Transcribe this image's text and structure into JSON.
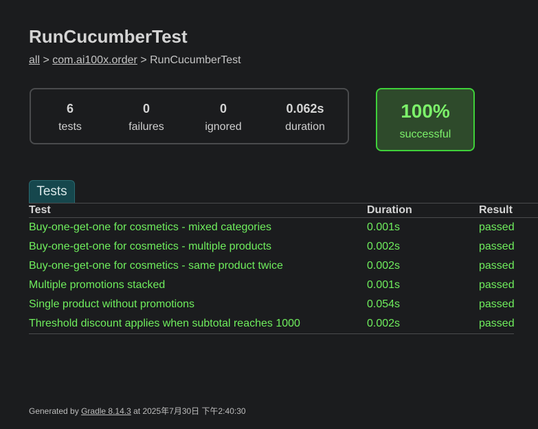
{
  "title": "RunCucumberTest",
  "breadcrumb": {
    "all": "all",
    "sep1": " > ",
    "package": "com.ai100x.order",
    "sep2": " > ",
    "current": "RunCucumberTest"
  },
  "summary": {
    "tests": {
      "value": "6",
      "label": "tests"
    },
    "failures": {
      "value": "0",
      "label": "failures"
    },
    "ignored": {
      "value": "0",
      "label": "ignored"
    },
    "duration": {
      "value": "0.062s",
      "label": "duration"
    }
  },
  "success": {
    "percent": "100%",
    "label": "successful"
  },
  "tab": {
    "label": "Tests"
  },
  "table": {
    "headers": {
      "test": "Test",
      "duration": "Duration",
      "result": "Result"
    },
    "rows": [
      {
        "test": "Buy-one-get-one for cosmetics - mixed categories",
        "duration": "0.001s",
        "result": "passed"
      },
      {
        "test": "Buy-one-get-one for cosmetics - multiple products",
        "duration": "0.002s",
        "result": "passed"
      },
      {
        "test": "Buy-one-get-one for cosmetics - same product twice",
        "duration": "0.002s",
        "result": "passed"
      },
      {
        "test": "Multiple promotions stacked",
        "duration": "0.001s",
        "result": "passed"
      },
      {
        "test": "Single product without promotions",
        "duration": "0.054s",
        "result": "passed"
      },
      {
        "test": "Threshold discount applies when subtotal reaches 1000",
        "duration": "0.002s",
        "result": "passed"
      }
    ]
  },
  "footer": {
    "prefix": "Generated by ",
    "link": "Gradle 8.14.3",
    "suffix": " at 2025年7月30日 下午2:40:30"
  },
  "colors": {
    "background": "#1b1c1e",
    "success_border": "#3fd13a",
    "success_text": "#7cf16a",
    "passed_text": "#6fee5d",
    "tab_bg": "#16474d"
  }
}
